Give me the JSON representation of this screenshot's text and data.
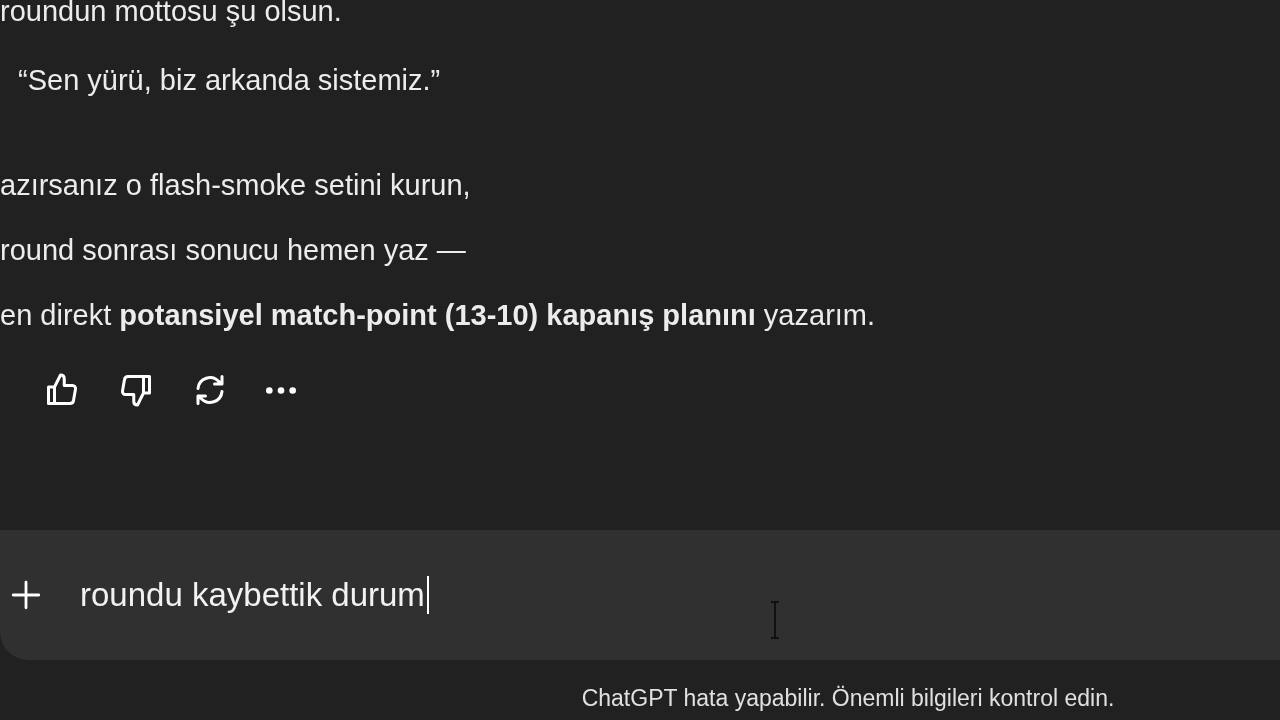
{
  "message": {
    "paragraphs": [
      {
        "kind": "plain",
        "text": "roundun mottosu şu olsun."
      },
      {
        "kind": "quote",
        "text": "“Sen yürü, biz arkanda sistemiz.”"
      },
      {
        "kind": "plain",
        "text": "azırsanız o flash-smoke setini kurun,"
      },
      {
        "kind": "plain",
        "text": "round sonrası sonucu hemen yaz —"
      },
      {
        "kind": "plain",
        "text": "en direkt **potansiyel match-point (13-10) kapanış planını** yazarım."
      }
    ],
    "actions": [
      {
        "kind": "like"
      },
      {
        "kind": "dislike"
      },
      {
        "kind": "regenerate"
      },
      {
        "kind": "more"
      }
    ]
  },
  "composer": {
    "value": "roundu kaybettik durum"
  },
  "disclaimer": "ChatGPT hata yapabilir. Önemli bilgileri kontrol edin."
}
